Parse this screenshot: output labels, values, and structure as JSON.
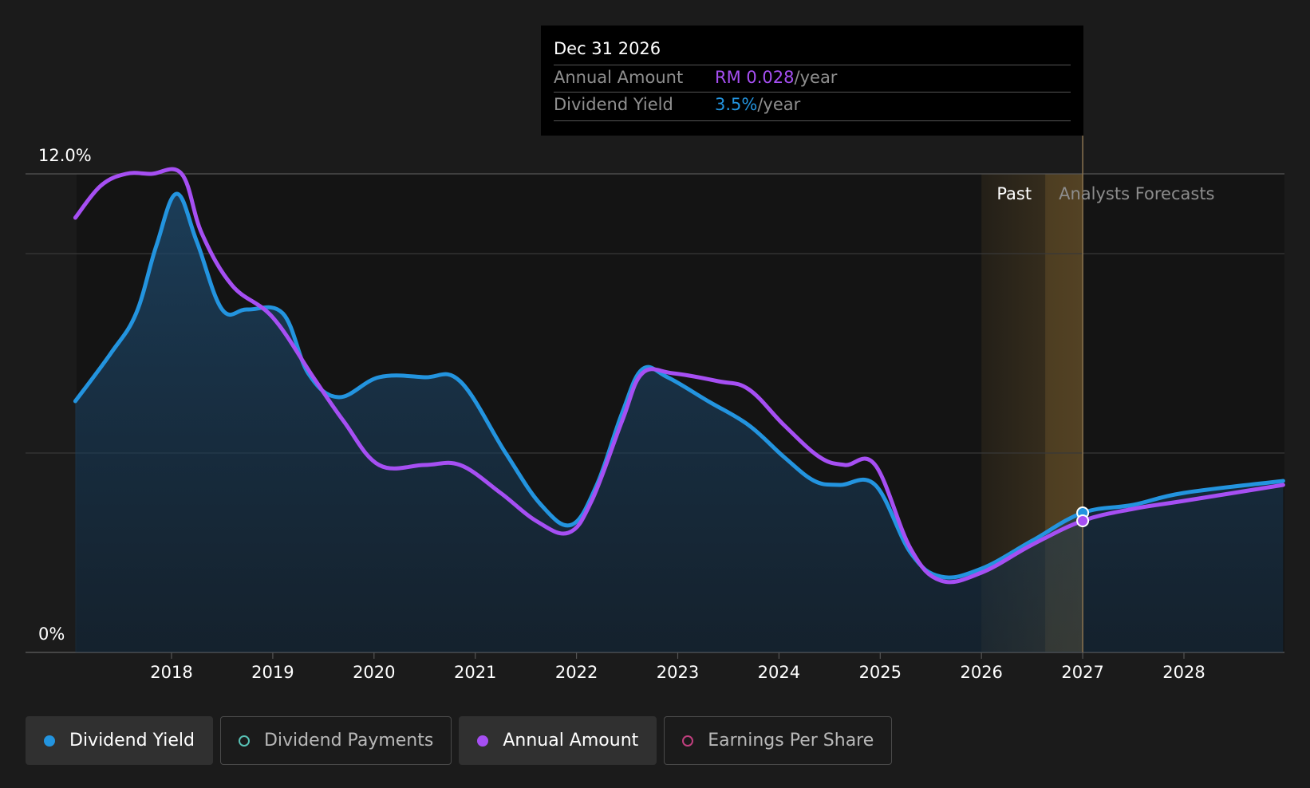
{
  "tooltip": {
    "date": "Dec 31 2026",
    "rows": [
      {
        "label": "Annual Amount",
        "value": "RM 0.028",
        "suffix": "/year",
        "color": "#a64ff3"
      },
      {
        "label": "Dividend Yield",
        "value": "3.5%",
        "suffix": "/year",
        "color": "#2394df"
      }
    ]
  },
  "regions": {
    "past_label": "Past",
    "forecast_label": "Analysts Forecasts"
  },
  "legend": [
    {
      "label": "Dividend Yield",
      "color": "#2394df",
      "active": true,
      "icon": "filled-circle-icon"
    },
    {
      "label": "Dividend Payments",
      "color": "#58c1b5",
      "active": false,
      "icon": "hollow-circle-icon"
    },
    {
      "label": "Annual Amount",
      "color": "#a64ff3",
      "active": true,
      "icon": "filled-circle-icon"
    },
    {
      "label": "Earnings Per Share",
      "color": "#c03f7e",
      "active": false,
      "icon": "hollow-circle-icon"
    }
  ],
  "chart_data": {
    "type": "line",
    "y_tick_labels": [
      "12.0%",
      "0%"
    ],
    "ylim": [
      0,
      12
    ],
    "x_ticks": [
      "2018",
      "2019",
      "2020",
      "2021",
      "2022",
      "2023",
      "2024",
      "2025",
      "2026",
      "2027",
      "2028"
    ],
    "xlim": [
      2017.05,
      2028.98
    ],
    "forecast_start": 2026.0,
    "highlight_date": 2027.0,
    "grid": true,
    "series": [
      {
        "name": "Dividend Yield",
        "color": "#2394df",
        "points": [
          [
            2017.05,
            6.3
          ],
          [
            2017.4,
            7.5
          ],
          [
            2017.65,
            8.5
          ],
          [
            2017.85,
            10.2
          ],
          [
            2018.05,
            11.5
          ],
          [
            2018.25,
            10.3
          ],
          [
            2018.5,
            8.6
          ],
          [
            2018.75,
            8.6
          ],
          [
            2019.1,
            8.5
          ],
          [
            2019.35,
            7.0
          ],
          [
            2019.65,
            6.4
          ],
          [
            2020.05,
            6.9
          ],
          [
            2020.5,
            6.9
          ],
          [
            2020.85,
            6.8
          ],
          [
            2021.3,
            5.0
          ],
          [
            2021.65,
            3.7
          ],
          [
            2021.95,
            3.2
          ],
          [
            2022.2,
            4.2
          ],
          [
            2022.45,
            6.0
          ],
          [
            2022.65,
            7.1
          ],
          [
            2022.9,
            6.9
          ],
          [
            2023.3,
            6.3
          ],
          [
            2023.7,
            5.7
          ],
          [
            2024.05,
            4.9
          ],
          [
            2024.35,
            4.3
          ],
          [
            2024.6,
            4.2
          ],
          [
            2024.95,
            4.2
          ],
          [
            2025.3,
            2.5
          ],
          [
            2025.6,
            1.9
          ],
          [
            2026.0,
            2.1
          ],
          [
            2026.5,
            2.8
          ],
          [
            2027.0,
            3.5
          ],
          [
            2027.5,
            3.7
          ],
          [
            2028.0,
            4.0
          ],
          [
            2028.98,
            4.3
          ]
        ]
      },
      {
        "name": "Annual Amount",
        "color": "#a64ff3",
        "points": [
          [
            2017.05,
            10.9
          ],
          [
            2017.3,
            11.7
          ],
          [
            2017.55,
            12.0
          ],
          [
            2017.8,
            12.0
          ],
          [
            2018.1,
            12.0
          ],
          [
            2018.3,
            10.5
          ],
          [
            2018.6,
            9.2
          ],
          [
            2019.0,
            8.4
          ],
          [
            2019.4,
            6.9
          ],
          [
            2019.7,
            5.8
          ],
          [
            2020.05,
            4.7
          ],
          [
            2020.5,
            4.7
          ],
          [
            2020.85,
            4.7
          ],
          [
            2021.25,
            4.0
          ],
          [
            2021.6,
            3.3
          ],
          [
            2021.92,
            3.0
          ],
          [
            2022.15,
            3.8
          ],
          [
            2022.45,
            5.8
          ],
          [
            2022.65,
            7.0
          ],
          [
            2022.95,
            7.0
          ],
          [
            2023.4,
            6.8
          ],
          [
            2023.7,
            6.6
          ],
          [
            2024.05,
            5.7
          ],
          [
            2024.4,
            4.9
          ],
          [
            2024.65,
            4.7
          ],
          [
            2024.95,
            4.7
          ],
          [
            2025.3,
            2.6
          ],
          [
            2025.6,
            1.8
          ],
          [
            2026.0,
            2.0
          ],
          [
            2026.5,
            2.7
          ],
          [
            2027.0,
            3.3
          ],
          [
            2027.5,
            3.6
          ],
          [
            2028.0,
            3.8
          ],
          [
            2028.98,
            4.2
          ]
        ]
      }
    ]
  }
}
